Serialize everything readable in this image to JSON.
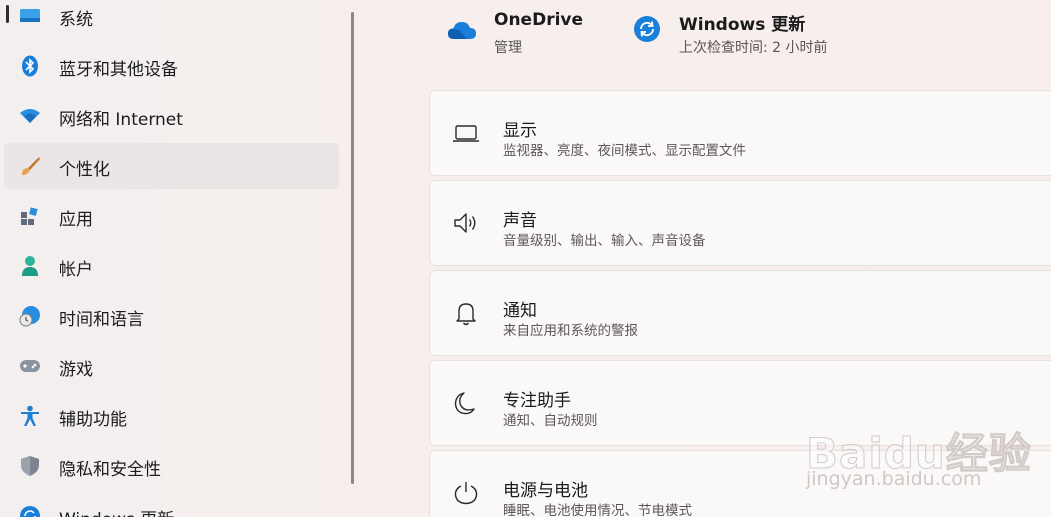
{
  "sidebar": {
    "items": [
      {
        "label": "系统",
        "icon": "system-icon"
      },
      {
        "label": "蓝牙和其他设备",
        "icon": "bluetooth-icon"
      },
      {
        "label": "网络和 Internet",
        "icon": "wifi-icon"
      },
      {
        "label": "个性化",
        "icon": "brush-icon",
        "selected": true
      },
      {
        "label": "应用",
        "icon": "apps-icon"
      },
      {
        "label": "帐户",
        "icon": "account-icon"
      },
      {
        "label": "时间和语言",
        "icon": "globe-clock-icon"
      },
      {
        "label": "游戏",
        "icon": "gamepad-icon"
      },
      {
        "label": "辅助功能",
        "icon": "accessibility-icon"
      },
      {
        "label": "隐私和安全性",
        "icon": "shield-icon"
      },
      {
        "label": "Windows 更新",
        "icon": "windows-update-icon"
      }
    ]
  },
  "top_info": {
    "onedrive": {
      "title": "OneDrive",
      "subtitle": "管理",
      "icon": "onedrive-cloud-icon"
    },
    "update": {
      "title": "Windows 更新",
      "subtitle": "上次检查时间: 2 小时前",
      "icon": "sync-icon"
    }
  },
  "cards": [
    {
      "title": "显示",
      "subtitle": "监视器、亮度、夜间模式、显示配置文件",
      "icon": "monitor-icon"
    },
    {
      "title": "声音",
      "subtitle": "音量级别、输出、输入、声音设备",
      "icon": "speaker-icon"
    },
    {
      "title": "通知",
      "subtitle": "来自应用和系统的警报",
      "icon": "bell-icon"
    },
    {
      "title": "专注助手",
      "subtitle": "通知、自动规则",
      "icon": "moon-icon"
    },
    {
      "title": "电源与电池",
      "subtitle": "睡眠、电池使用情况、节电模式",
      "icon": "power-icon"
    }
  ],
  "watermark": {
    "main": "Baidu经验",
    "sub": "jingyan.baidu.com"
  },
  "colors": {
    "accent": "#0067c0",
    "selected_bg": "#ebe5e5",
    "card_bg": "#fbf8f8"
  }
}
